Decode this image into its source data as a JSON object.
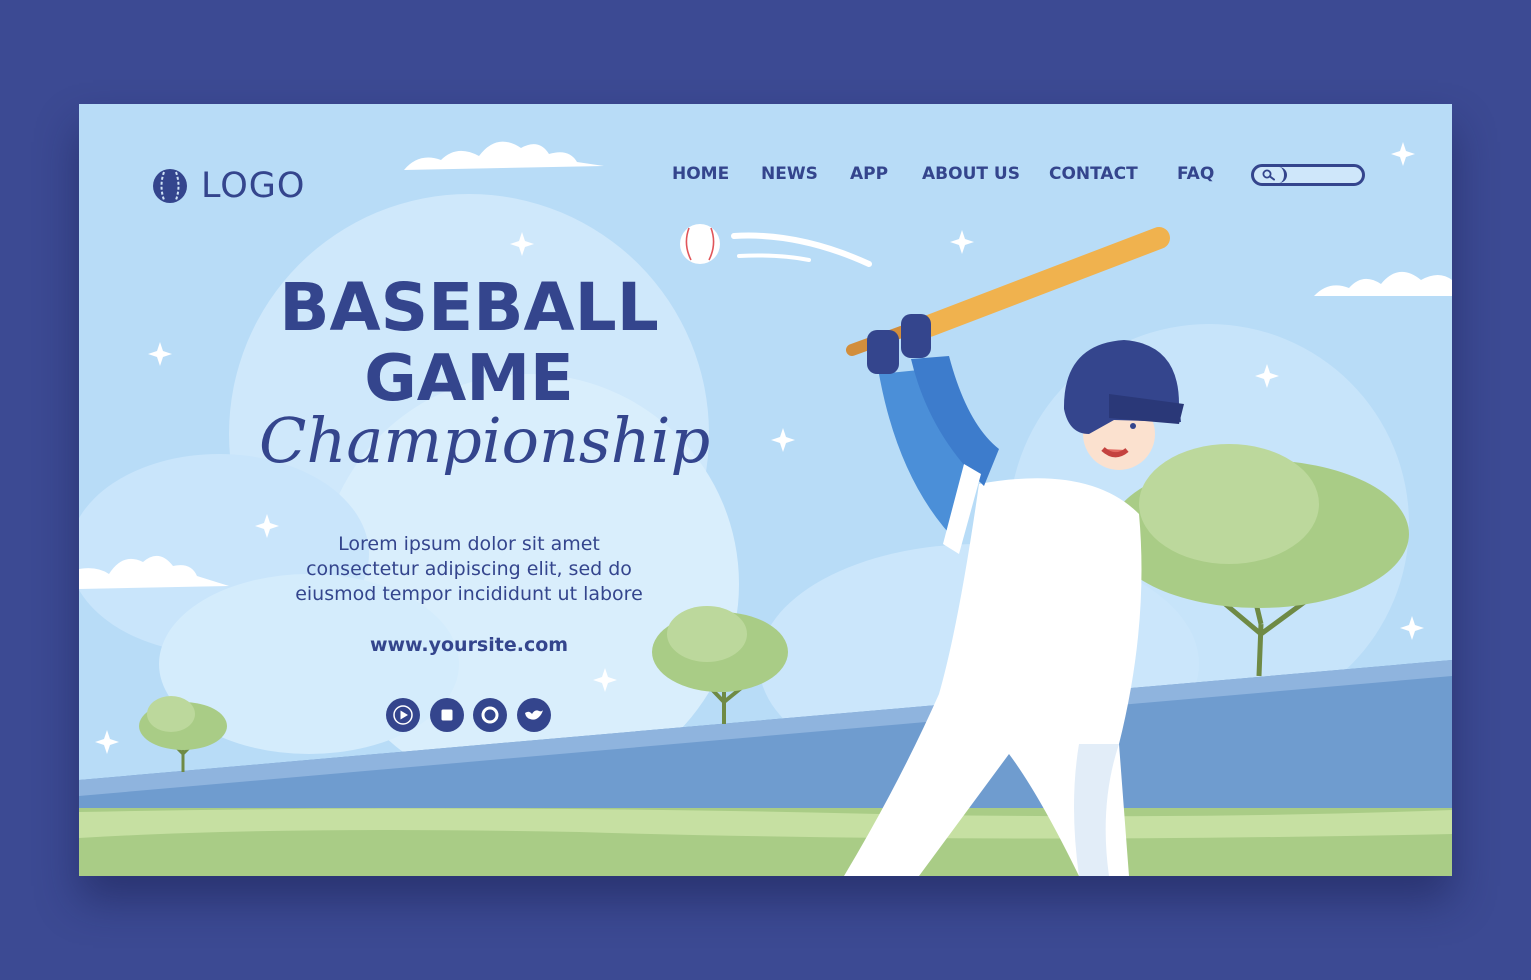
{
  "brand": {
    "logo_text": "LOGO",
    "logo_icon": "baseball-icon"
  },
  "nav": {
    "items": [
      {
        "label": "HOME"
      },
      {
        "label": "NEWS"
      },
      {
        "label": "APP"
      },
      {
        "label": "ABOUT US"
      },
      {
        "label": "CONTACT"
      },
      {
        "label": "FAQ"
      }
    ],
    "search_icon": "magnifier-icon"
  },
  "hero": {
    "title_line1": "BASEBALL",
    "title_line2": "GAME",
    "title_line3": "Championship",
    "description_lines": [
      "Lorem ipsum dolor sit amet",
      "consectetur adipiscing elit, sed do",
      "eiusmod tempor incididunt ut labore"
    ],
    "url": "www.yoursite.com"
  },
  "social": [
    {
      "icon": "play-icon"
    },
    {
      "icon": "stop-icon"
    },
    {
      "icon": "circle-icon"
    },
    {
      "icon": "bird-icon"
    }
  ],
  "colors": {
    "frame": "#3c4a93",
    "sky": "#b8dcf7",
    "text": "#34458d",
    "grass": "#9fc77a",
    "field": "#6f9ccf"
  }
}
